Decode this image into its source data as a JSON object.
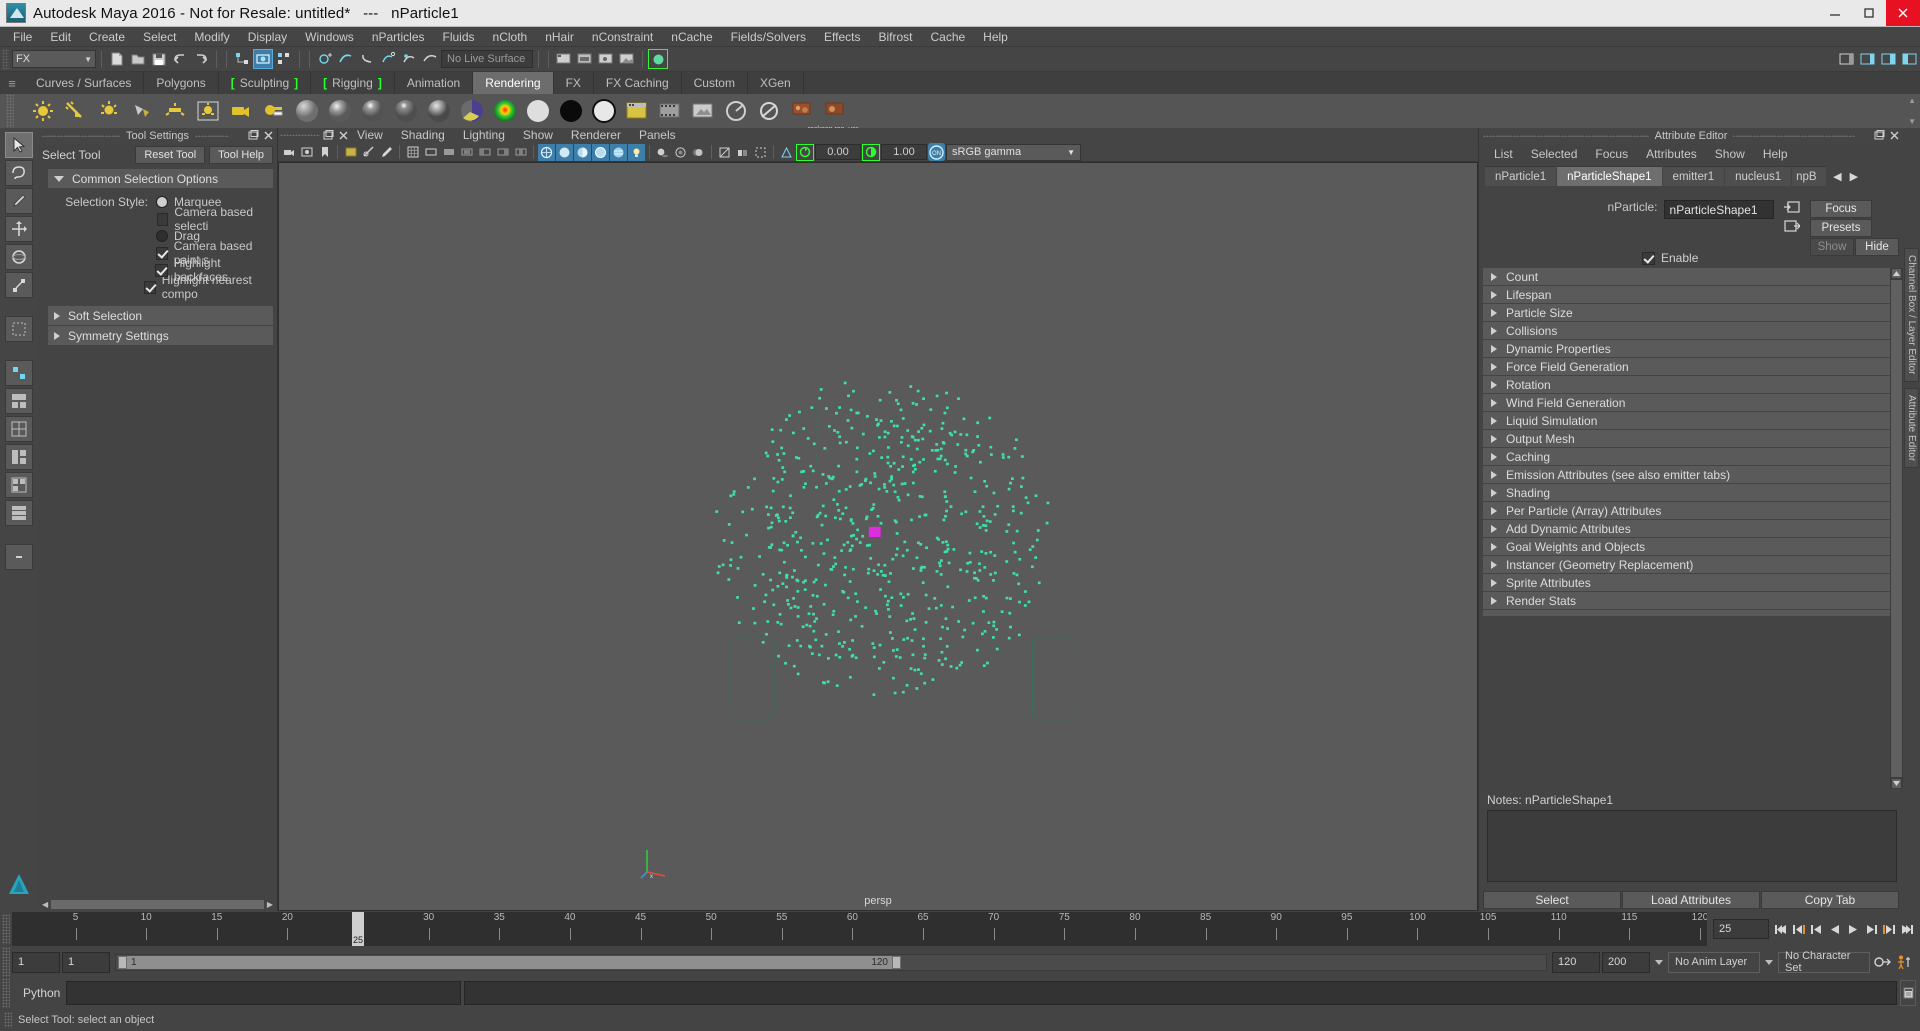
{
  "window": {
    "title": "Autodesk Maya 2016 - Not for Resale: untitled*   ---   nParticle1",
    "minimize": "–",
    "maximize": "▢",
    "close": "✕"
  },
  "menubar": {
    "items": [
      "File",
      "Edit",
      "Create",
      "Select",
      "Modify",
      "Display",
      "Windows",
      "nParticles",
      "Fluids",
      "nCloth",
      "nHair",
      "nConstraint",
      "nCache",
      "Fields/Solvers",
      "Effects",
      "Bifrost",
      "Cache",
      "Help"
    ]
  },
  "statusline": {
    "menuset": "FX",
    "live_surface": "No Live Surface"
  },
  "shelf": {
    "tabs": [
      {
        "label": "Curves / Surfaces",
        "selected": false,
        "bracket": false
      },
      {
        "label": "Polygons",
        "selected": false,
        "bracket": false
      },
      {
        "label": "Sculpting",
        "selected": false,
        "bracket": true
      },
      {
        "label": "Rigging",
        "selected": false,
        "bracket": true
      },
      {
        "label": "Animation",
        "selected": false,
        "bracket": false
      },
      {
        "label": "Rendering",
        "selected": true,
        "bracket": false
      },
      {
        "label": "FX",
        "selected": false,
        "bracket": false
      },
      {
        "label": "FX Caching",
        "selected": false,
        "bracket": false
      },
      {
        "label": "Custom",
        "selected": false,
        "bracket": false
      },
      {
        "label": "XGen",
        "selected": false,
        "bracket": false
      }
    ],
    "buttons": [
      "ambient-light-icon",
      "directional-light-icon",
      "point-light-icon",
      "spot-light-icon",
      "volume-light-icon",
      "area-light-icon",
      "camera-icon",
      "image-plane-icon",
      "lambert-material-icon",
      "blinn-material-icon",
      "phong-material-icon",
      "phonge-material-icon",
      "anisotropic-material-icon",
      "layered-shader-icon",
      "ramp-shader-icon",
      "surface-shader-icon",
      "use-background-icon",
      "shading-map-icon",
      "render-view-icon",
      "render-sequence-icon",
      "batch-render-icon",
      "ipr-render-icon",
      "render-settings-icon",
      "rockgen-ran-ver-icon"
    ],
    "custom_button_label": "rockgen ran_ver"
  },
  "toolbox": {
    "tools": [
      "select-tool",
      "lasso-select-tool",
      "paint-select-tool",
      "move-tool",
      "rotate-tool",
      "scale-tool",
      "last-tool-used",
      "snap-grid-icon",
      "snap-curve-icon",
      "snap-point-icon",
      "snap-view-plane-icon",
      "snap-projected-center-icon",
      "layout-single-icon",
      "layout-four-view-icon",
      "layout-persp-outliner-icon",
      "layout-persp-graph-icon",
      "layout-hypershade-icon",
      "dash-icon"
    ]
  },
  "tool_settings": {
    "panel_title": "Tool Settings",
    "tool_name": "Select Tool",
    "reset_label": "Reset Tool",
    "help_label": "Tool Help",
    "frames": [
      {
        "label": "Common Selection Options",
        "open": true
      },
      {
        "label": "Soft Selection",
        "open": false
      },
      {
        "label": "Symmetry Settings",
        "open": false
      }
    ],
    "selection_style_label": "Selection Style:",
    "options": [
      {
        "type": "radio",
        "label": "Marquee",
        "checked": true,
        "indent": 0
      },
      {
        "type": "checkbox",
        "label": "Camera based selecti",
        "checked": false,
        "indent": 1
      },
      {
        "type": "radio",
        "label": "Drag",
        "checked": false,
        "indent": 0
      },
      {
        "type": "checkbox",
        "label": "Camera based paint s",
        "checked": true,
        "indent": 1
      },
      {
        "type": "checkbox",
        "label": "Highlight backfaces",
        "checked": true,
        "indent": 0
      },
      {
        "type": "checkbox",
        "label": "Highlight nearest compo",
        "checked": true,
        "indent": 0
      }
    ]
  },
  "viewport": {
    "menus": [
      "View",
      "Shading",
      "Lighting",
      "Show",
      "Renderer",
      "Panels"
    ],
    "gamma_exposure": "0.00",
    "gamma_value": "1.00",
    "color_space": "sRGB gamma",
    "camera_label": "persp",
    "background_color": "#5a5a5a",
    "particle_color": "#3fe0a8"
  },
  "attribute_editor": {
    "panel_title": "Attribute Editor",
    "menus": [
      "List",
      "Selected",
      "Focus",
      "Attributes",
      "Show",
      "Help"
    ],
    "tabs": [
      {
        "label": "nParticle1",
        "selected": false
      },
      {
        "label": "nParticleShape1",
        "selected": true
      },
      {
        "label": "emitter1",
        "selected": false
      },
      {
        "label": "nucleus1",
        "selected": false
      },
      {
        "label": "npB",
        "selected": false
      }
    ],
    "node_label": "nParticle:",
    "node_value": "nParticleShape1",
    "focus_label": "Focus",
    "presets_label": "Presets",
    "show_label": "Show",
    "hide_label": "Hide",
    "enable_label": "Enable",
    "enable_checked": true,
    "sections": [
      "Count",
      "Lifespan",
      "Particle Size",
      "Collisions",
      "Dynamic Properties",
      "Force Field Generation",
      "Rotation",
      "Wind Field Generation",
      "Liquid Simulation",
      "Output Mesh",
      "Caching",
      "Emission Attributes (see also emitter tabs)",
      "Shading",
      "Per Particle (Array) Attributes",
      "Add Dynamic Attributes",
      "Goal Weights and Objects",
      "Instancer (Geometry Replacement)",
      "Sprite Attributes",
      "Render Stats"
    ],
    "notes_label": "Notes: nParticleShape1",
    "bottom_buttons": [
      "Select",
      "Load Attributes",
      "Copy Tab"
    ]
  },
  "right_tabs": [
    "Channel Box / Layer Editor",
    "Attribute Editor"
  ],
  "timeline": {
    "ticks": [
      5,
      10,
      15,
      20,
      25,
      30,
      35,
      40,
      45,
      50,
      55,
      60,
      65,
      70,
      75,
      80,
      85,
      90,
      95,
      100,
      105,
      110,
      115,
      120
    ],
    "start": 1,
    "end": 120,
    "current_frame": 25,
    "current_frame_field": "25",
    "playback_buttons": [
      "go-to-start",
      "step-back-key",
      "step-back-frame",
      "play-backwards",
      "play-forwards",
      "step-forward-frame",
      "step-forward-key",
      "go-to-end"
    ]
  },
  "range": {
    "anim_start": "1",
    "range_start": "1",
    "bar_left_label": "1",
    "bar_right_label": "120",
    "range_end": "120",
    "anim_end": "200",
    "anim_layer": "No Anim Layer",
    "character_set": "No Character Set",
    "auto_key_icon": "auto-keyframe-icon",
    "anim_prefs_icon": "animation-preferences-icon"
  },
  "command_line": {
    "language": "Python",
    "input_value": "",
    "output_value": "",
    "script_editor_icon": "script-editor-icon"
  },
  "help_line": {
    "message": "Select Tool: select an object"
  },
  "colors": {
    "accent_blue": "#3d7fa8",
    "green_highlight": "#2cff2c",
    "panel_bg": "#444444",
    "shelf_bg": "#555555",
    "viewport_bg": "#5a5a5a",
    "title_bg": "#e9e9e9",
    "close_red": "#e81123"
  }
}
